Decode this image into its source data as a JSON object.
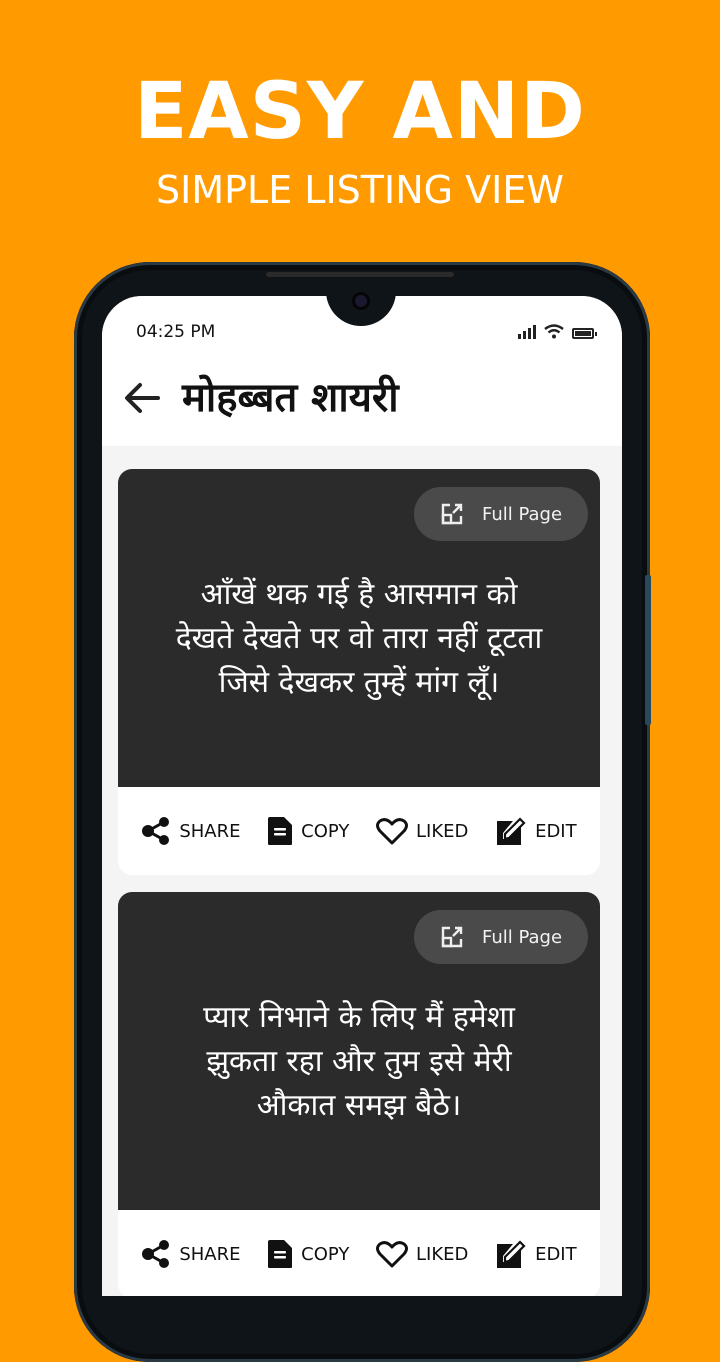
{
  "promo": {
    "headline": "EASY AND",
    "subheadline": "SIMPLE LISTING VIEW",
    "background_color": "#ff9a00"
  },
  "status_bar": {
    "time": "04:25 PM",
    "icons": [
      "signal-icon",
      "wifi-icon",
      "battery-icon"
    ]
  },
  "app_bar": {
    "back_icon": "arrow-left-icon",
    "title": "मोहब्बत शायरी"
  },
  "cards": [
    {
      "full_page_label": "Full Page",
      "full_page_icon": "open-external-icon",
      "quote_lines": [
        "आँखें थक गई है आसमान को",
        "देखते देखते पर वो तारा नहीं टूटता",
        "जिसे देखकर तुम्हें मांग लूँ।"
      ],
      "actions": [
        {
          "label": "SHARE",
          "icon": "share-icon"
        },
        {
          "label": "COPY",
          "icon": "copy-icon"
        },
        {
          "label": "LIKED",
          "icon": "heart-icon"
        },
        {
          "label": "EDIT",
          "icon": "edit-icon"
        }
      ]
    },
    {
      "full_page_label": "Full Page",
      "full_page_icon": "open-external-icon",
      "quote_lines": [
        "प्यार निभाने के लिए मैं हमेशा",
        "झुकता रहा और तुम इसे मेरी",
        "औकात समझ बैठे।"
      ],
      "actions": [
        {
          "label": "SHARE",
          "icon": "share-icon"
        },
        {
          "label": "COPY",
          "icon": "copy-icon"
        },
        {
          "label": "LIKED",
          "icon": "heart-icon"
        },
        {
          "label": "EDIT",
          "icon": "edit-icon"
        }
      ]
    }
  ]
}
